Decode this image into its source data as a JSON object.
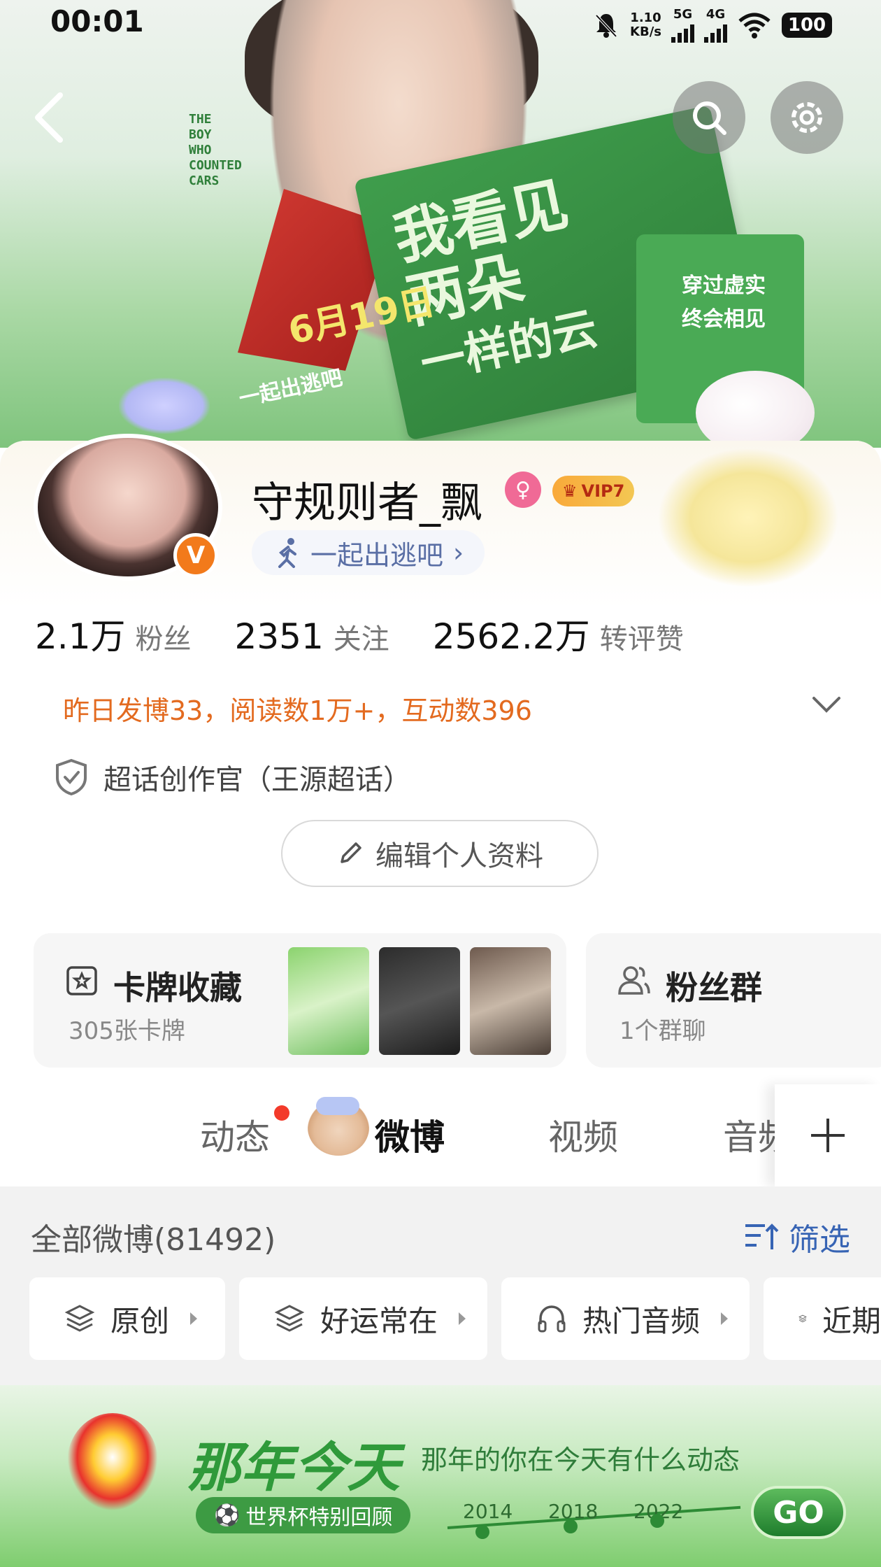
{
  "status_bar": {
    "time": "00:01",
    "speed_value": "1.10",
    "speed_unit": "KB/s",
    "net1": "5G",
    "net2": "4G",
    "battery": "100"
  },
  "banner": {
    "date_text": "6月19日",
    "slogan": [
      "我看见",
      "两朵",
      "一样的云"
    ],
    "escape_text": "一起出逃吧",
    "side_text_1": "穿过虚实",
    "side_text_2": "终会相见",
    "english_text": "THE\nBOY\nWHO\nCOUNTED\nCARS"
  },
  "profile": {
    "username": "守规则者_飘",
    "verified_badge": "V",
    "vip_label": "VIP7",
    "tag_chip": "一起出逃吧",
    "stats": [
      {
        "num": "2.1万",
        "label": "粉丝"
      },
      {
        "num": "2351",
        "label": "关注"
      },
      {
        "num": "2562.2万",
        "label": "转评赞"
      }
    ],
    "activity_summary": "昨日发博33，阅读数1万+，互动数396",
    "super_topic": "超话创作官（王源超话）",
    "edit_button": "编辑个人资料"
  },
  "cards": {
    "collection": {
      "title": "卡牌收藏",
      "subtitle": "305张卡牌"
    },
    "fan_group": {
      "title": "粉丝群",
      "subtitle": "1个群聊"
    }
  },
  "tabs": [
    {
      "label": "动态"
    },
    {
      "label": "微博"
    },
    {
      "label": "视频"
    },
    {
      "label": "音频"
    }
  ],
  "feed": {
    "all_weibo": "全部微博(81492)",
    "filter_label": "筛选",
    "chips": [
      "原创",
      "好运常在",
      "热门音频",
      "近期"
    ]
  },
  "promo": {
    "title": "那年今天",
    "subtitle": "那年的你在今天有什么动态",
    "tag": "世界杯特别回顾",
    "years": [
      "2014",
      "2018",
      "2022"
    ],
    "go": "GO"
  },
  "colors": {
    "accent_orange": "#e36a1f",
    "link_blue": "#3764b4",
    "verified_orange": "#f27a1b",
    "promo_green": "#2f9a3a"
  }
}
